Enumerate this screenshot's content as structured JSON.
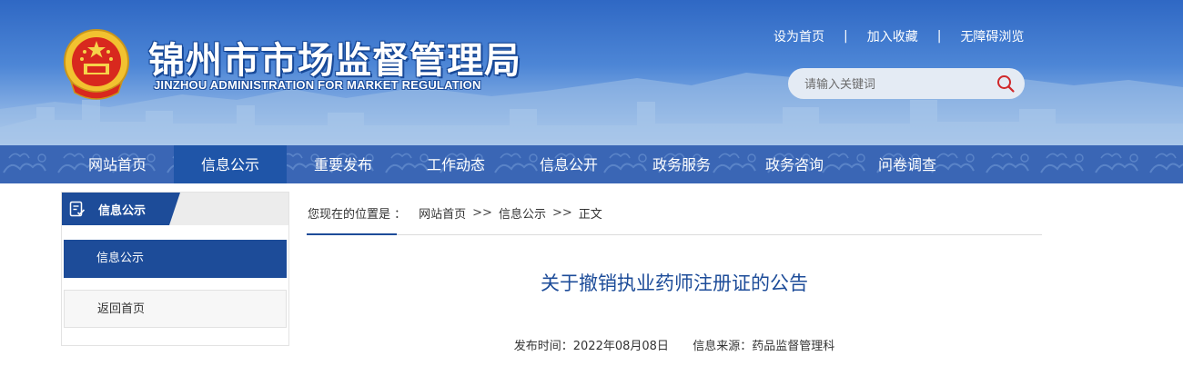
{
  "header": {
    "title": "锦州市市场监督管理局",
    "subtitle": "JINZHOU ADMINISTRATION FOR MARKET REGULATION",
    "links": [
      "设为首页",
      "加入收藏",
      "无障碍浏览"
    ],
    "link_separator": "|",
    "search": {
      "placeholder": "请输入关键词"
    }
  },
  "nav": {
    "items": [
      "网站首页",
      "信息公示",
      "重要发布",
      "工作动态",
      "信息公开",
      "政务服务",
      "政务咨询",
      "问卷调查"
    ],
    "active": "信息公示"
  },
  "sidebar": {
    "heading": "信息公示",
    "items": [
      "信息公示",
      "返回首页"
    ]
  },
  "breadcrumb": {
    "lead": "您现在的位置是 ：",
    "items": [
      "网站首页",
      "信息公示",
      "正文"
    ],
    "separator": ">>"
  },
  "article": {
    "title": "关于撤销执业药师注册证的公告",
    "publish_time": "发布时间：2022年08月08日",
    "source": "信息来源：药品监督管理科"
  },
  "colors": {
    "primary": "#1d4c99",
    "nav_bg": "#3a66b5",
    "header_top": "#2f68c4"
  },
  "icons": {
    "emblem": "national-emblem-icon",
    "search": "search-icon",
    "sidebar": "checklist-icon"
  }
}
